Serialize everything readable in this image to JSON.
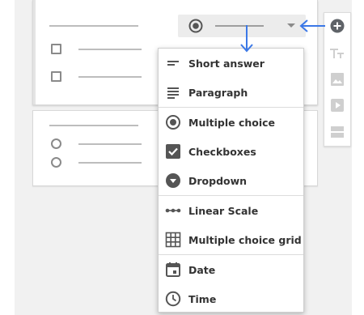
{
  "menu": {
    "items": [
      {
        "label": "Short answer",
        "icon": "short-answer-icon"
      },
      {
        "label": "Paragraph",
        "icon": "paragraph-icon"
      },
      {
        "label": "Multiple choice",
        "icon": "radio-button-icon"
      },
      {
        "label": "Checkboxes",
        "icon": "checkbox-icon"
      },
      {
        "label": "Dropdown",
        "icon": "dropdown-icon"
      },
      {
        "label": "Linear Scale",
        "icon": "linear-scale-icon"
      },
      {
        "label": "Multiple choice grid",
        "icon": "grid-icon"
      },
      {
        "label": "Date",
        "icon": "calendar-icon"
      },
      {
        "label": "Time",
        "icon": "clock-icon"
      }
    ]
  },
  "toolbar": {
    "buttons": [
      "add-question-icon",
      "title-text-icon",
      "image-icon",
      "video-icon",
      "section-icon"
    ]
  },
  "colors": {
    "accent_arrow": "#3b78e7",
    "icon_gray": "#555555",
    "toolbar_icon_gray": "#cfcfcf",
    "add_button": "#5f6368"
  }
}
